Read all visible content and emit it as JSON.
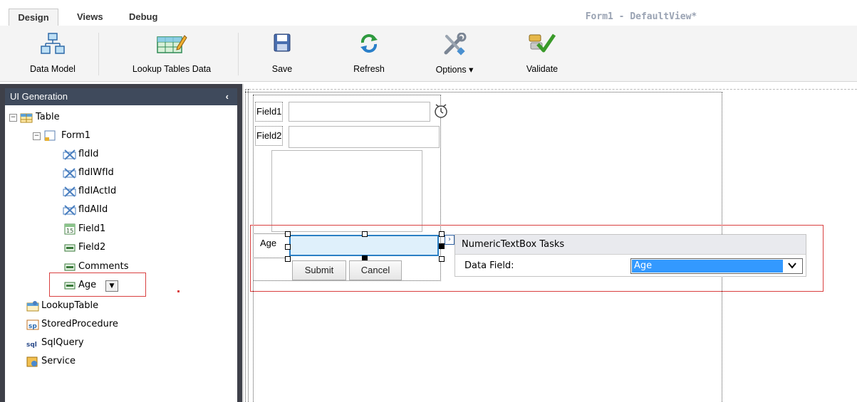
{
  "tabs": [
    "Design",
    "Views",
    "Debug"
  ],
  "document_title": "Form1 - DefaultView*",
  "ribbon": {
    "data_model": "Data Model",
    "lookup_tables_data": "Lookup Tables Data",
    "save": "Save",
    "refresh": "Refresh",
    "options": "Options",
    "validate": "Validate"
  },
  "sidebar": {
    "header": "UI Generation",
    "collapse_glyph": "‹",
    "tree": {
      "table": "Table",
      "form1": "Form1",
      "fields": [
        "fldId",
        "fldIWfId",
        "fldIActId",
        "fldAIId",
        "Field1",
        "Field2",
        "Comments",
        "Age"
      ],
      "lookup_table": "LookupTable",
      "stored_procedure": "StoredProcedure",
      "sql_query": "SqlQuery",
      "service": "Service"
    }
  },
  "form": {
    "field1_label": "Field1",
    "field2_label": "Field2",
    "age_label": "Age",
    "submit": "Submit",
    "cancel": "Cancel"
  },
  "tasks_panel": {
    "title": "NumericTextBox Tasks",
    "data_field_label": "Data Field:",
    "data_field_value": "Age"
  },
  "colors": {
    "selection_blue": "#3399ff",
    "highlight_red": "#d94040",
    "sidebar_dark": "#3f4a5c"
  }
}
